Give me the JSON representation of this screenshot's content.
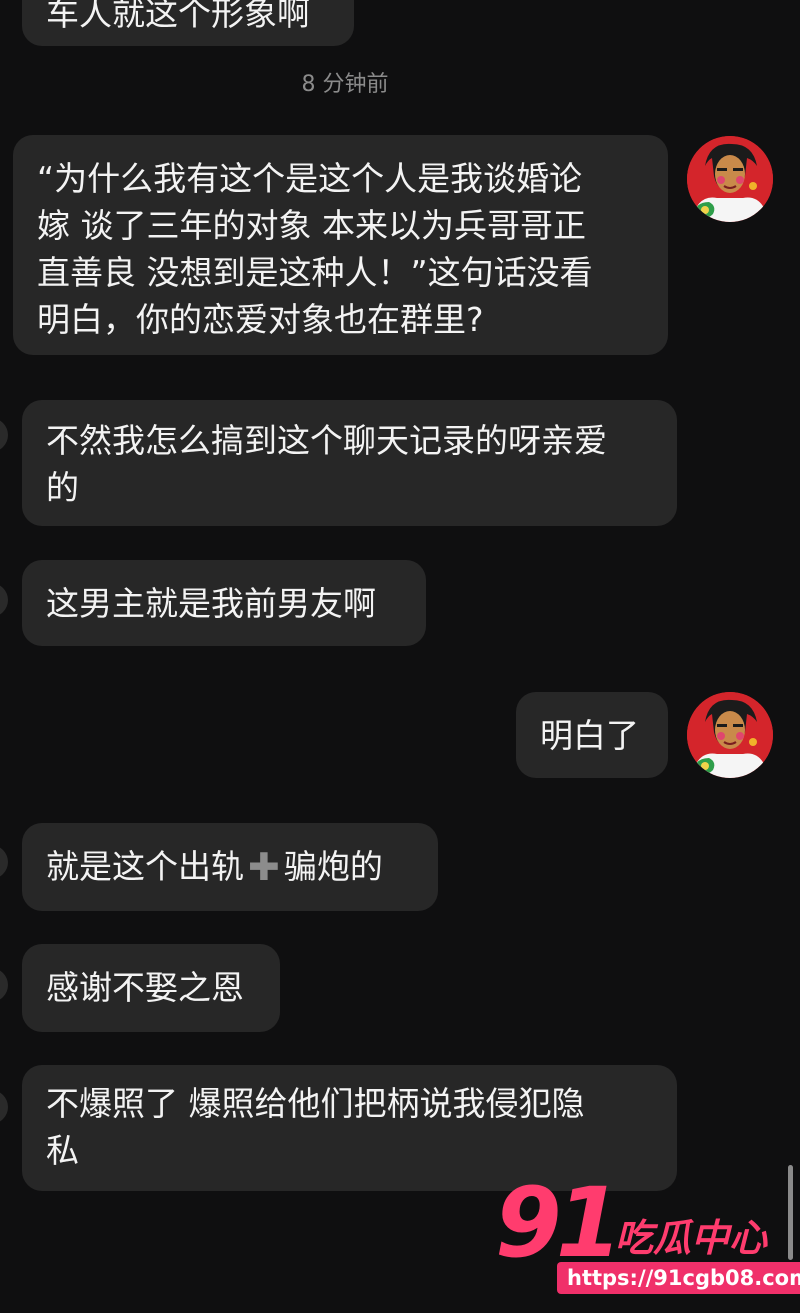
{
  "messages": {
    "top_cut": "车人就这个形象啊",
    "timestamp": "8 分钟前",
    "quote_line1": "“为什么我有这个是这个人是我谈婚论",
    "quote_line2": "嫁 谈了三年的对象 本来以为兵哥哥正",
    "quote_line3": "直善良 没想到是这种人！”这句话没看",
    "quote_line4": "明白，你的恋爱对象也在群里?",
    "reply1_line1": "不然我怎么搞到这个聊天记录的呀亲爱",
    "reply1_line2": "的",
    "reply2": "这男主就是我前男友啊",
    "sent_understood": "明白了",
    "reply3_before": "就是这个出轨",
    "reply3_emoji": "✚",
    "reply3_after": "骗炮的",
    "reply4": "感谢不娶之恩",
    "reply5_line1": "不爆照了 爆照给他们把柄说我侵犯隐",
    "reply5_line2": "私"
  },
  "watermark": {
    "number": "91",
    "name": "吃瓜中心",
    "url": "https://91cgb08.com"
  },
  "colors": {
    "background": "#0f0f10",
    "bubble": "#272727",
    "watermark": "#ff3c6e"
  }
}
